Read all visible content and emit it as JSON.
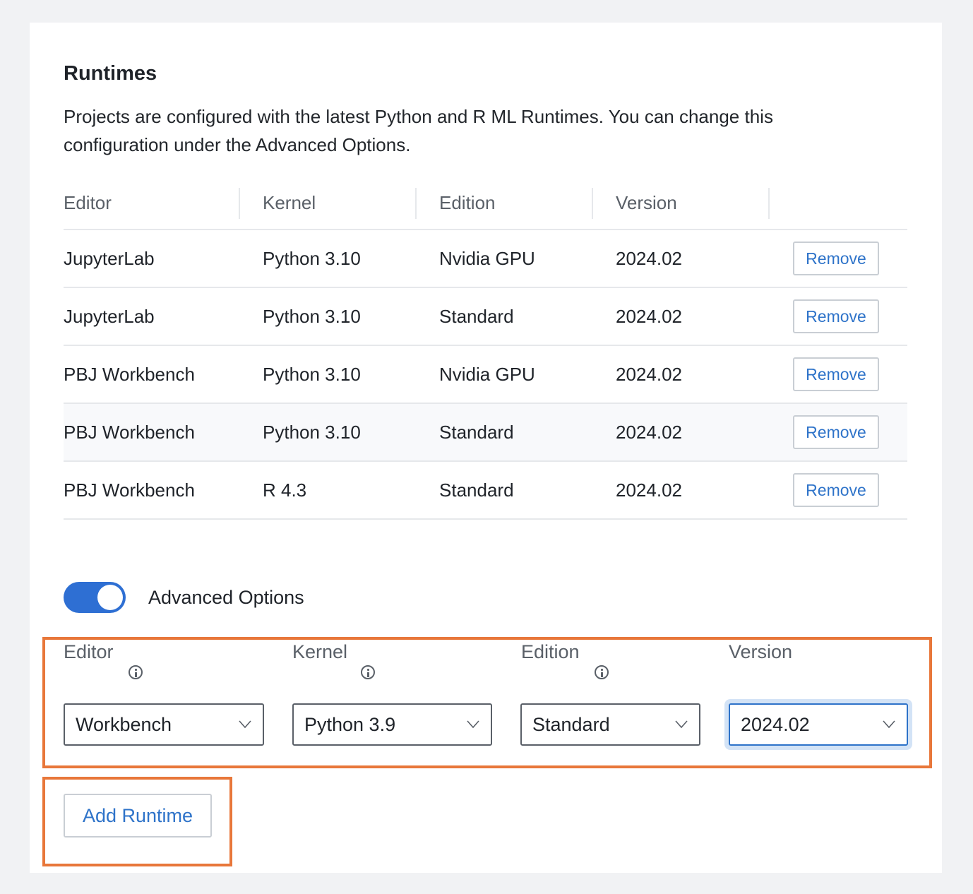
{
  "section": {
    "title": "Runtimes",
    "description": "Projects are configured with the latest Python and R ML Runtimes. You can change this configuration under the Advanced Options."
  },
  "table": {
    "columns": [
      "Editor",
      "Kernel",
      "Edition",
      "Version"
    ],
    "rows": [
      {
        "editor": "JupyterLab",
        "kernel": "Python 3.10",
        "edition": "Nvidia GPU",
        "version": "2024.02",
        "action": "Remove"
      },
      {
        "editor": "JupyterLab",
        "kernel": "Python 3.10",
        "edition": "Standard",
        "version": "2024.02",
        "action": "Remove"
      },
      {
        "editor": "PBJ Workbench",
        "kernel": "Python 3.10",
        "edition": "Nvidia GPU",
        "version": "2024.02",
        "action": "Remove"
      },
      {
        "editor": "PBJ Workbench",
        "kernel": "Python 3.10",
        "edition": "Standard",
        "version": "2024.02",
        "action": "Remove"
      },
      {
        "editor": "PBJ Workbench",
        "kernel": "R 4.3",
        "edition": "Standard",
        "version": "2024.02",
        "action": "Remove"
      }
    ]
  },
  "advanced": {
    "toggle_label": "Advanced Options",
    "toggle_on": true
  },
  "form": {
    "editor_label": "Editor",
    "editor_value": "Workbench",
    "kernel_label": "Kernel",
    "kernel_value": "Python 3.9",
    "edition_label": "Edition",
    "edition_value": "Standard",
    "version_label": "Version",
    "version_value": "2024.02"
  },
  "add_button_label": "Add Runtime",
  "colors": {
    "accent": "#2e6fd3",
    "link": "#2e73c9",
    "highlight": "#e8773a"
  }
}
